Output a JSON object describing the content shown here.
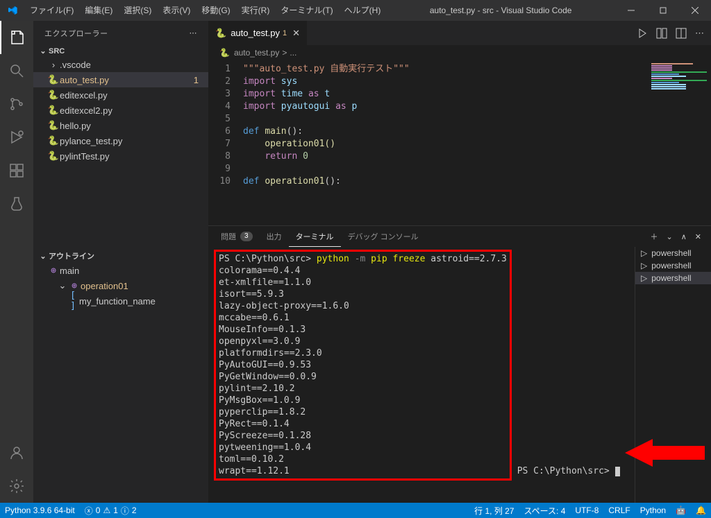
{
  "title": "auto_test.py - src - Visual Studio Code",
  "menu": [
    "ファイル(F)",
    "編集(E)",
    "選択(S)",
    "表示(V)",
    "移動(G)",
    "実行(R)",
    "ターミナル(T)",
    "ヘルプ(H)"
  ],
  "sidebar": {
    "header": "エクスプローラー",
    "root": "SRC",
    "files": {
      "folder0": ".vscode",
      "f0": "auto_test.py",
      "f0count": "1",
      "f1": "editexcel.py",
      "f2": "editexcel2.py",
      "f3": "hello.py",
      "f4": "pylance_test.py",
      "f5": "pylintTest.py"
    },
    "outline": {
      "header": "アウトライン",
      "main": "main",
      "op": "operation01",
      "var": "my_function_name"
    }
  },
  "tab": {
    "name": "auto_test.py",
    "mod": "1"
  },
  "crumbs": {
    "file": "auto_test.py",
    "sep": ">",
    "rest": "..."
  },
  "code": {
    "l1a": "\"\"\"auto_test.py ",
    "l1b": "自動実行テスト\"\"\"",
    "l2": "import",
    "l2m": " sys",
    "l3": "import",
    "l3m": " time ",
    "l3k": "as",
    "l3m2": " t",
    "l4": "import",
    "l4m": " pyautogui ",
    "l4k": "as",
    "l4m2": " p",
    "l6": "def ",
    "l6f": "main",
    "l6p": "():",
    "l7": "    operation01()",
    "l8a": "    ",
    "l8": "return ",
    "l8n": "0",
    "l10": "def ",
    "l10f": "operation01",
    "l10p": "():"
  },
  "panel": {
    "problems": "問題",
    "problems_count": "3",
    "output": "出力",
    "terminal": "ターミナル",
    "debug": "デバッグ コンソール"
  },
  "terminal": {
    "prompt": "PS C:\\Python\\src> ",
    "cmd_py": "python ",
    "cmd_opt": "-m ",
    "cmd_rest": "pip freeze",
    "output": "astroid==2.7.3\ncolorama==0.4.4\net-xmlfile==1.1.0\nisort==5.9.3\nlazy-object-proxy==1.6.0\nmccabe==0.6.1\nMouseInfo==0.1.3\nopenpyxl==3.0.9\nplatformdirs==2.3.0\nPyAutoGUI==0.9.53\nPyGetWindow==0.0.9\npylint==2.10.2\nPyMsgBox==1.0.9\npyperclip==1.8.2\nPyRect==0.1.4\nPyScreeze==0.1.28\npytweening==1.0.4\ntoml==0.10.2\nwrapt==1.12.1",
    "prompt2": "PS C:\\Python\\src> "
  },
  "termlist": {
    "t0": "powershell",
    "t1": "powershell",
    "t2": "powershell"
  },
  "status": {
    "python": "Python 3.9.6 64-bit",
    "err": "0",
    "warn": "1",
    "info": "2",
    "line": "行 1, 列 27",
    "spaces": "スペース: 4",
    "enc": "UTF-8",
    "eol": "CRLF",
    "lang": "Python"
  }
}
